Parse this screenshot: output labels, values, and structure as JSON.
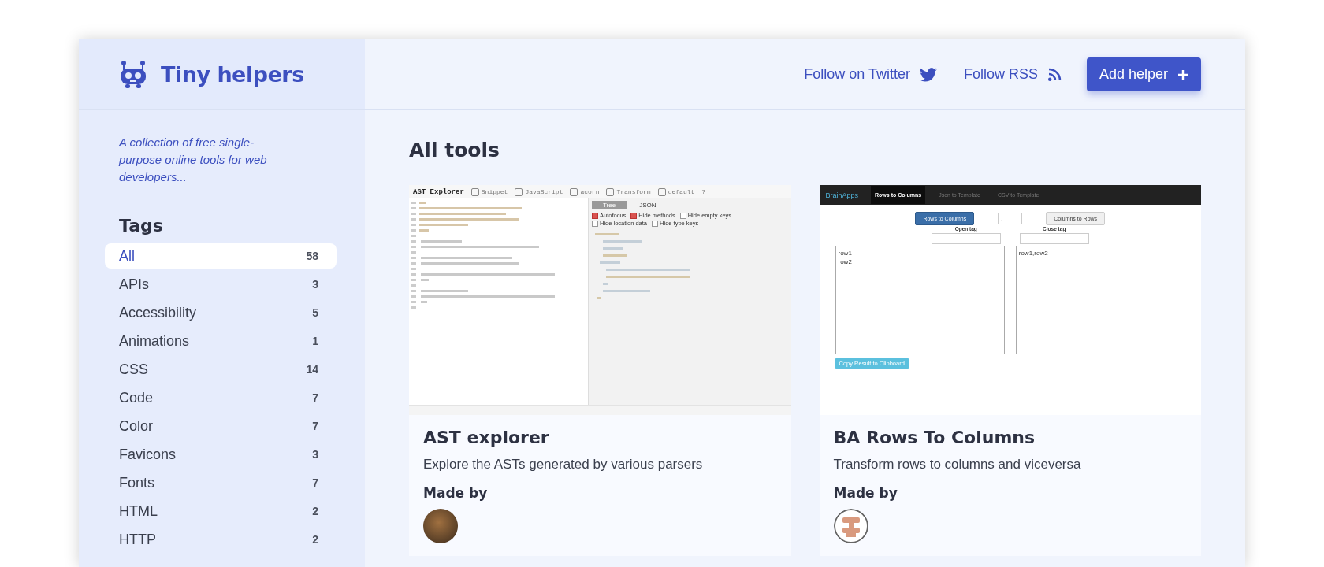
{
  "brand": {
    "name": "Tiny helpers"
  },
  "header": {
    "links": [
      {
        "label": "Follow on Twitter",
        "kind": "twitter"
      },
      {
        "label": "Follow RSS",
        "kind": "rss"
      }
    ],
    "action": {
      "label": "Add helper"
    }
  },
  "sidebar": {
    "description": "A collection of free single-purpose online tools for web developers...",
    "heading": "Tags",
    "tags": [
      {
        "label": "All",
        "count": "58",
        "selected": true
      },
      {
        "label": "APIs",
        "count": "3",
        "selected": false
      },
      {
        "label": "Accessibility",
        "count": "5",
        "selected": false
      },
      {
        "label": "Animations",
        "count": "1",
        "selected": false
      },
      {
        "label": "CSS",
        "count": "14",
        "selected": false
      },
      {
        "label": "Code",
        "count": "7",
        "selected": false
      },
      {
        "label": "Color",
        "count": "7",
        "selected": false
      },
      {
        "label": "Favicons",
        "count": "3",
        "selected": false
      },
      {
        "label": "Fonts",
        "count": "7",
        "selected": false
      },
      {
        "label": "HTML",
        "count": "2",
        "selected": false
      },
      {
        "label": "HTTP",
        "count": "2",
        "selected": false
      }
    ]
  },
  "main": {
    "heading": "All tools",
    "tools": [
      {
        "title": "AST explorer",
        "description": "Explore the ASTs generated by various parsers",
        "made_by": "Made by",
        "avatar": {
          "kind": "photo"
        },
        "preview": {
          "kind": "ast_explorer",
          "title": "AST Explorer",
          "toolbar": [
            {
              "label": "Snippet",
              "icon": true
            },
            {
              "label": "JavaScript",
              "icon": true
            },
            {
              "label": "acorn",
              "icon": true
            },
            {
              "label": "Transform",
              "icon": true
            },
            {
              "label": "default",
              "icon": true
            },
            {
              "label": "?",
              "icon": false
            }
          ],
          "tabs": [
            {
              "label": "Tree",
              "selected": true
            },
            {
              "label": "JSON",
              "selected": false
            }
          ],
          "options": [
            {
              "label": "Autofocus",
              "checked": true
            },
            {
              "label": "Hide methods",
              "checked": true
            },
            {
              "label": "Hide empty keys",
              "checked": false
            },
            {
              "label": "Hide location data",
              "checked": false
            },
            {
              "label": "Hide type keys",
              "checked": false
            }
          ]
        }
      },
      {
        "title": "BA Rows To Columns",
        "description": "Transform rows to columns and viceversa",
        "made_by": "Made by",
        "avatar": {
          "kind": "logo"
        },
        "preview": {
          "kind": "rows_to_columns",
          "brand": "BrainApps",
          "tabs": [
            {
              "label": "Rows to Columns",
              "selected": true
            },
            {
              "label": "Json to Template",
              "selected": false
            },
            {
              "label": "CSV to Template",
              "selected": false
            }
          ],
          "primary_button": "Rows to Columns",
          "select_value": ",",
          "secondary_button": "Columns to Rows",
          "fields": [
            {
              "label": "Open tag"
            },
            {
              "label": "Close tag"
            }
          ],
          "input_lines": [
            "row1",
            "row2"
          ],
          "output_text": "row1,row2",
          "copy_button": "Copy Result to Clipboard"
        }
      }
    ]
  }
}
